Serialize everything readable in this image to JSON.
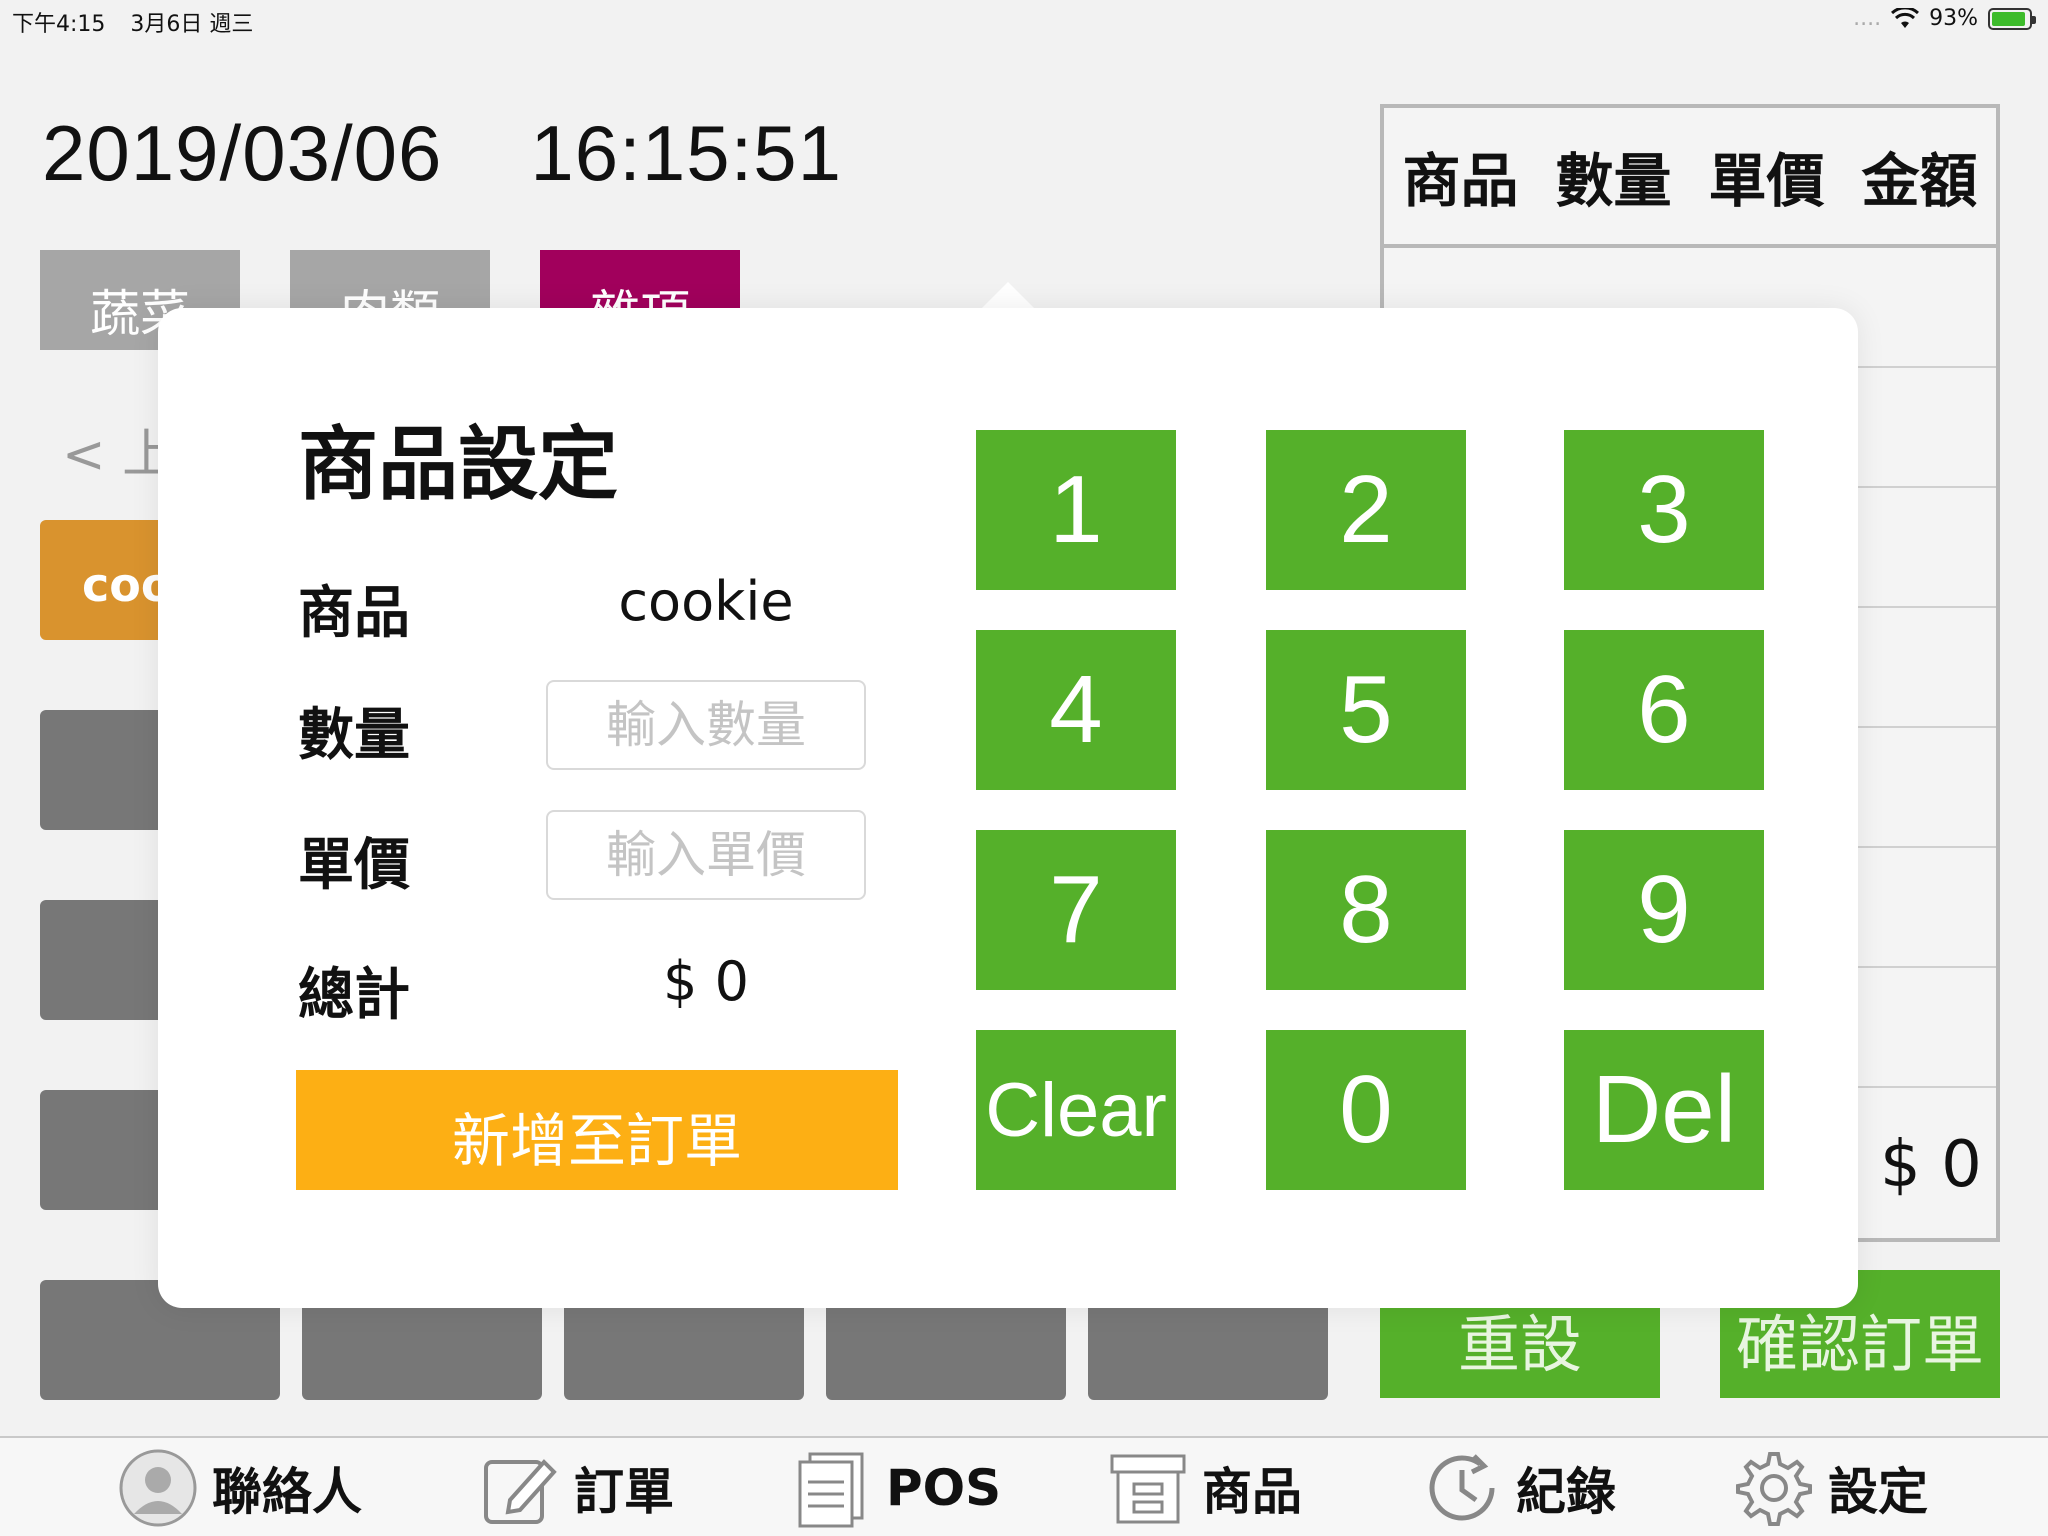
{
  "status_bar": {
    "time": "下午4:15",
    "date": "3月6日 週三",
    "signal": "....",
    "battery": "93%",
    "battery_level": 0.93
  },
  "header": {
    "date": "2019/03/06",
    "time": "16:15:51"
  },
  "categories": [
    {
      "label": "蔬菜",
      "active": false
    },
    {
      "label": "肉類",
      "active": false
    },
    {
      "label": "雜項",
      "active": true
    }
  ],
  "products": {
    "prev_label": "< 上",
    "first_tile": "coo"
  },
  "order": {
    "columns": [
      "商品",
      "數量",
      "單價",
      "金額"
    ],
    "total": "$ 0",
    "reset_label": "重設",
    "confirm_label": "確認訂單"
  },
  "modal": {
    "title": "商品設定",
    "product_label": "商品",
    "product_value": "cookie",
    "quantity_label": "數量",
    "quantity_placeholder": "輸入數量",
    "price_label": "單價",
    "price_placeholder": "輸入單價",
    "total_label": "總計",
    "total_value": "$ 0",
    "add_button": "新增至訂單",
    "keys": [
      "1",
      "2",
      "3",
      "4",
      "5",
      "6",
      "7",
      "8",
      "9",
      "Clear",
      "0",
      "Del"
    ]
  },
  "tabbar": [
    {
      "label": "聯絡人",
      "icon": "contact-icon"
    },
    {
      "label": "訂單",
      "icon": "edit-icon"
    },
    {
      "label": "POS",
      "icon": "document-icon"
    },
    {
      "label": "商品",
      "icon": "archive-icon"
    },
    {
      "label": "紀錄",
      "icon": "clock-icon"
    },
    {
      "label": "設定",
      "icon": "gear-icon"
    }
  ],
  "colors": {
    "keypad_green": "#55b02a",
    "add_orange": "#fdaf14",
    "active_category": "#a1005c",
    "product_tile": "#d9932e"
  }
}
